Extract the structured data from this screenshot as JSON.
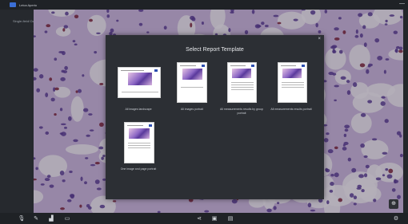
{
  "app": {
    "title": "Leica Aperio"
  },
  "side": {
    "path_label": "Single-field/ Database..."
  },
  "modal": {
    "title": "Select Report Template",
    "close_label": "×",
    "templates": [
      {
        "caption": "All images landscape"
      },
      {
        "caption": "All images portrait"
      },
      {
        "caption": "All measurements results by group portrait"
      },
      {
        "caption": "All measurements results portrait"
      },
      {
        "caption": "One image and page portrait"
      }
    ]
  },
  "icons": {
    "edit": "pencil-icon",
    "minimize": "minimize-icon",
    "zoom": "zoom-in-icon",
    "close": "close-icon"
  },
  "glyphs": {
    "edit": "/",
    "minimize": "—",
    "zoom": "⊕",
    "mic": "🎙",
    "brush": "✎",
    "chart": "▟",
    "screen": "▭",
    "share": "⋖",
    "save": "▣",
    "doc": "▤",
    "settings": "⚙"
  }
}
